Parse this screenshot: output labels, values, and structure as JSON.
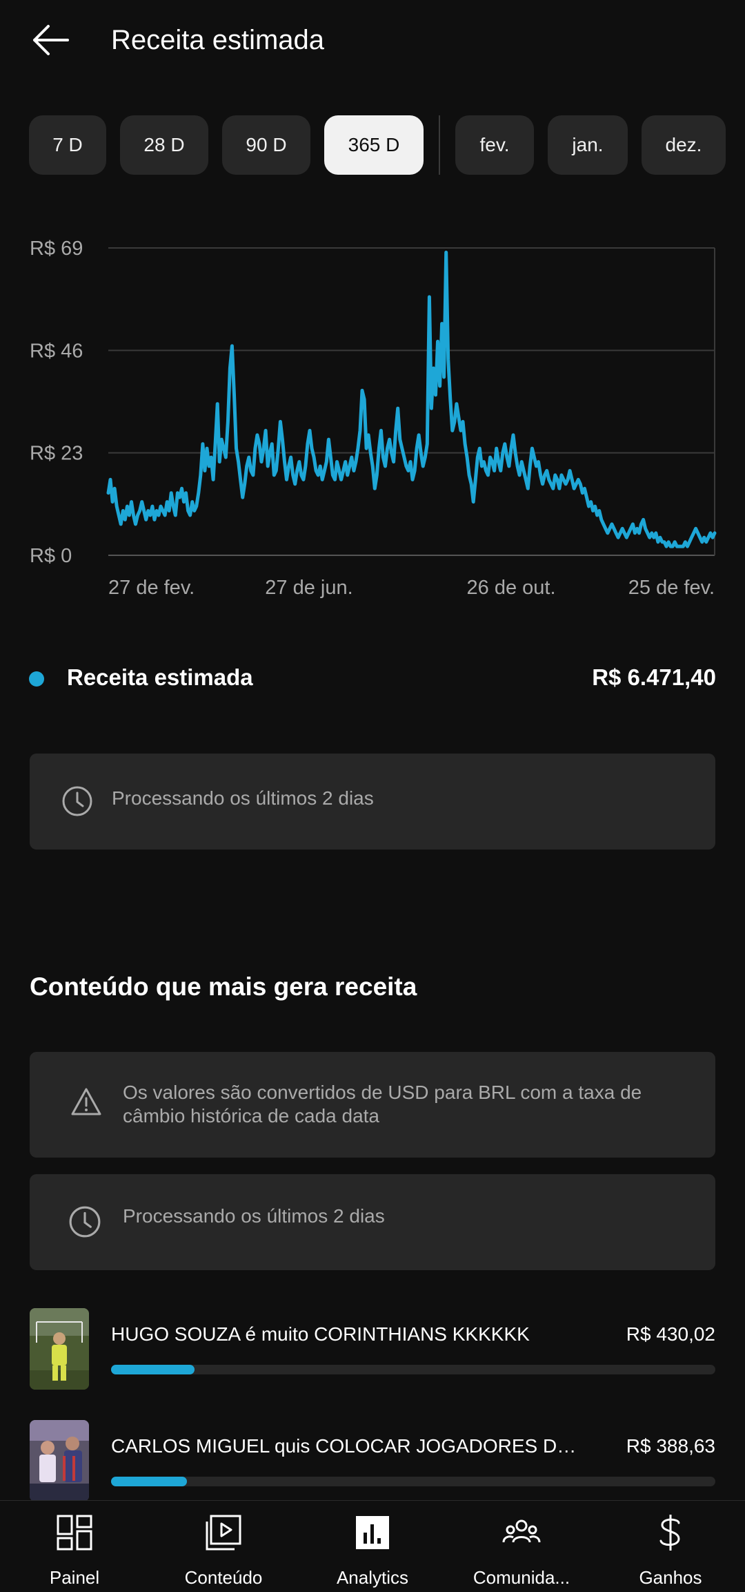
{
  "header": {
    "title": "Receita estimada"
  },
  "chips": {
    "ranges": [
      "7 D",
      "28 D",
      "90 D",
      "365 D"
    ],
    "months": [
      "fev.",
      "jan.",
      "dez."
    ],
    "selected": "365 D"
  },
  "chart_data": {
    "type": "line",
    "title": "",
    "xlabel": "",
    "ylabel": "",
    "y_ticks": [
      "R$ 69",
      "R$ 46",
      "R$ 23",
      "R$ 0"
    ],
    "x_ticks": [
      "27 de fev.",
      "27 de jun.",
      "26 de out.",
      "25 de fev."
    ],
    "ylim": [
      0,
      69
    ],
    "grid": true,
    "color": "#1ea7d7",
    "series": [
      {
        "name": "Receita estimada",
        "values": [
          14,
          17,
          12,
          15,
          11,
          9,
          7,
          10,
          8,
          11,
          9,
          12,
          9,
          7,
          9,
          10,
          12,
          10,
          8,
          10,
          9,
          11,
          8,
          10,
          9,
          11,
          10,
          9,
          12,
          10,
          14,
          11,
          9,
          14,
          13,
          15,
          12,
          14,
          10,
          9,
          12,
          10,
          11,
          14,
          18,
          25,
          19,
          24,
          20,
          22,
          17,
          25,
          34,
          21,
          26,
          24,
          22,
          30,
          42,
          47,
          36,
          24,
          21,
          17,
          13,
          16,
          20,
          22,
          19,
          18,
          24,
          27,
          25,
          21,
          24,
          28,
          20,
          23,
          25,
          18,
          19,
          24,
          30,
          26,
          21,
          17,
          20,
          22,
          18,
          16,
          19,
          21,
          18,
          17,
          20,
          25,
          28,
          24,
          22,
          19,
          18,
          20,
          17,
          19,
          21,
          26,
          22,
          18,
          17,
          21,
          19,
          17,
          19,
          21,
          18,
          20,
          22,
          19,
          21,
          24,
          28,
          37,
          35,
          24,
          27,
          23,
          20,
          15,
          18,
          24,
          28,
          22,
          20,
          24,
          26,
          23,
          21,
          28,
          33,
          26,
          24,
          22,
          20,
          19,
          21,
          17,
          19,
          24,
          27,
          23,
          20,
          22,
          25,
          58,
          33,
          42,
          36,
          48,
          38,
          52,
          40,
          68,
          44,
          35,
          28,
          30,
          34,
          31,
          28,
          30,
          25,
          22,
          18,
          16,
          12,
          17,
          22,
          24,
          20,
          21,
          19,
          18,
          22,
          21,
          19,
          24,
          21,
          19,
          23,
          25,
          22,
          20,
          24,
          27,
          23,
          20,
          18,
          21,
          19,
          17,
          15,
          20,
          24,
          22,
          20,
          21,
          18,
          16,
          18,
          19,
          17,
          16,
          15,
          18,
          17,
          15,
          18,
          17,
          16,
          17,
          19,
          17,
          15,
          16,
          17,
          16,
          14,
          15,
          13,
          11,
          12,
          10,
          11,
          9,
          10,
          8,
          7,
          6,
          5,
          6,
          7,
          6,
          5,
          4,
          5,
          6,
          5,
          4,
          5,
          6,
          7,
          5,
          6,
          5,
          7,
          8,
          6,
          5,
          4,
          5,
          4,
          5,
          3,
          4,
          3,
          3,
          2,
          3,
          2,
          2,
          3,
          2,
          2,
          2,
          2,
          3,
          2,
          3,
          4,
          5,
          6,
          5,
          4,
          3,
          4,
          3,
          4,
          5,
          4,
          5
        ]
      }
    ]
  },
  "legend": {
    "label": "Receita estimada",
    "value": "R$ 6.471,40",
    "color": "#1ea7d7"
  },
  "processing_card_1": {
    "text": "Processando os últimos 2 dias"
  },
  "section": {
    "title": "Conteúdo que mais gera receita"
  },
  "conversion_card": {
    "text": "Os valores são convertidos de USD para BRL com a taxa de câmbio histórica de cada data"
  },
  "processing_card_2": {
    "text": "Processando os últimos 2 dias"
  },
  "content_rows": [
    {
      "title": "HUGO SOUZA é muito CORINTHIANS KKKKKK",
      "value": "R$ 430,02",
      "share": 0.138
    },
    {
      "title": "CARLOS MIGUEL quis COLOCAR JOGADORES DO…",
      "value": "R$ 388,63",
      "share": 0.125
    }
  ],
  "bottom_nav": [
    {
      "label": "Painel",
      "icon": "dashboard-icon"
    },
    {
      "label": "Conteúdo",
      "icon": "content-icon"
    },
    {
      "label": "Analytics",
      "icon": "analytics-icon"
    },
    {
      "label": "Comunida...",
      "icon": "community-icon"
    },
    {
      "label": "Ganhos",
      "icon": "dollar-icon"
    }
  ]
}
